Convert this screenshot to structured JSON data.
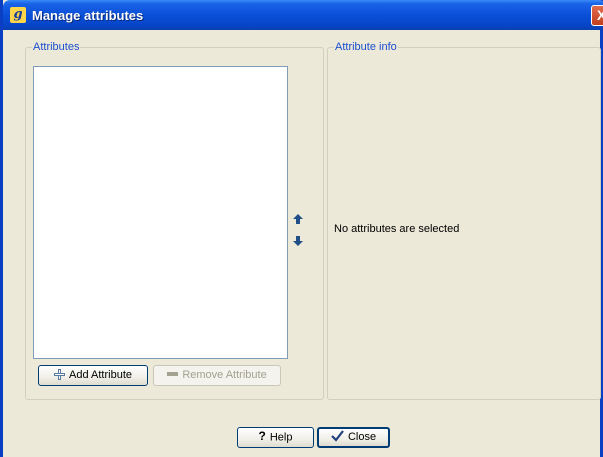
{
  "window": {
    "title": "Manage attributes",
    "app_icon_glyph": "g",
    "close_glyph": "X"
  },
  "attributes_group": {
    "label": "Attributes",
    "items": [],
    "add_button": "Add Attribute",
    "remove_button": "Remove Attribute"
  },
  "info_group": {
    "label": "Attribute info",
    "message": "No attributes are selected"
  },
  "footer": {
    "help_glyph": "?",
    "help_button": "Help",
    "close_button": "Close"
  },
  "icons": {
    "move_up": "arrow-up-icon",
    "move_down": "arrow-down-icon",
    "add": "plus-icon",
    "remove": "minus-icon",
    "help": "question-mark-icon",
    "close": "checkmark-icon"
  },
  "colors": {
    "titlebar": "#0a4fd8",
    "group_label": "#1b4ecf",
    "window_bg": "#ece9d8",
    "arrow": "#1f4e89"
  }
}
